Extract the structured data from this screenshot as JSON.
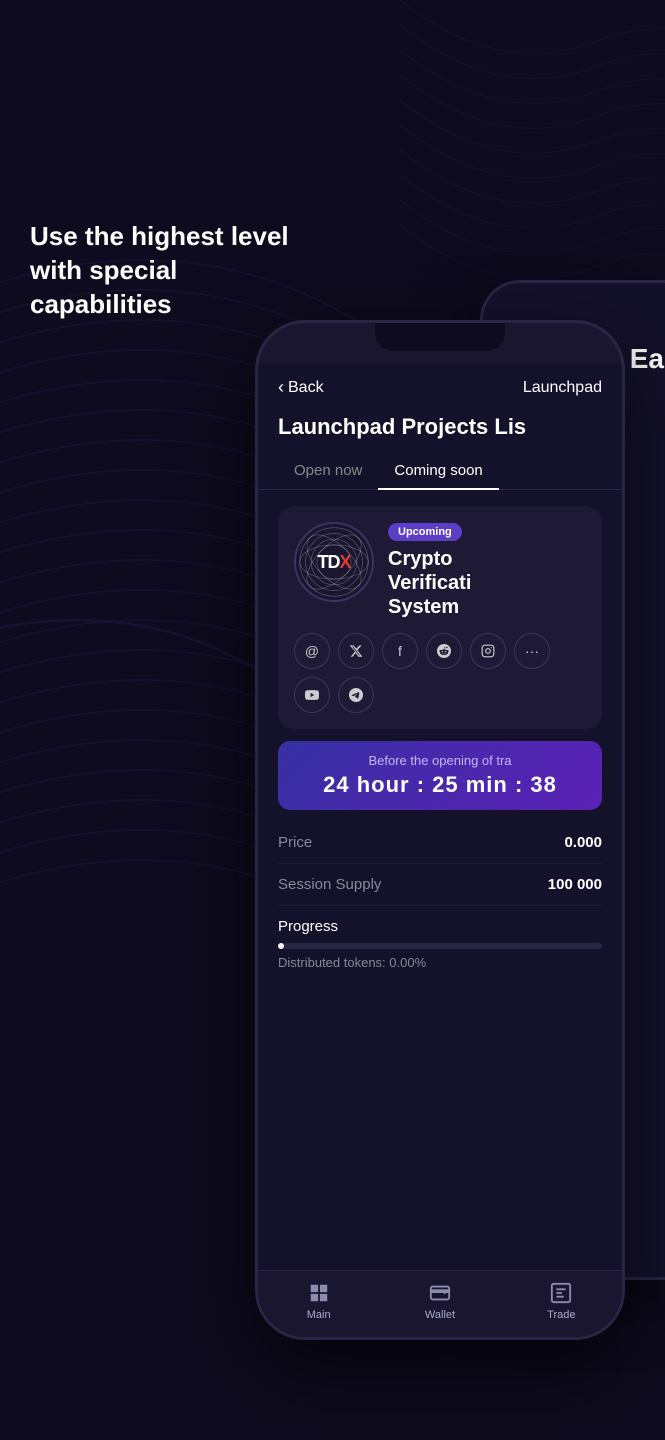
{
  "background": {
    "color": "#0e0b1e"
  },
  "headline": {
    "text": "Use the highest level with special capabilities"
  },
  "phone": {
    "header": {
      "back_label": "Back",
      "title": "Launchpad"
    },
    "page_title": "Launchpad Projects Lis",
    "tabs": [
      {
        "label": "Open now",
        "active": false
      },
      {
        "label": "Coming soon",
        "active": true
      }
    ],
    "project": {
      "badge": "Upcoming",
      "logo_text_main": "TDX",
      "logo_text_accent": "X",
      "name_line1": "Crypto",
      "name_line2": "Verificati",
      "name_line3": "System"
    },
    "social_icons": [
      {
        "name": "at-icon",
        "symbol": "@"
      },
      {
        "name": "twitter-icon",
        "symbol": "𝕏"
      },
      {
        "name": "facebook-icon",
        "symbol": "f"
      },
      {
        "name": "reddit-icon",
        "symbol": "r"
      },
      {
        "name": "instagram-icon",
        "symbol": "◻"
      },
      {
        "name": "extra-icon",
        "symbol": "…"
      },
      {
        "name": "youtube-icon",
        "symbol": "▶"
      },
      {
        "name": "telegram-icon",
        "symbol": "✈"
      }
    ],
    "timer": {
      "label": "Before the opening of tra",
      "value": "24 hour : 25 min : 38"
    },
    "price": {
      "label": "Price",
      "value": "0.000"
    },
    "session_supply": {
      "label": "Session Supply",
      "value": "100 000"
    },
    "progress": {
      "label": "Progress",
      "fill_percent": 2,
      "distributed_text": "Distributed tokens: 0.00%"
    },
    "bottom_nav": [
      {
        "name": "main-nav",
        "icon": "⊞",
        "label": "Main"
      },
      {
        "name": "wallet-nav",
        "icon": "▣",
        "label": "Wallet"
      },
      {
        "name": "trade-nav",
        "icon": "⊟",
        "label": "Trade"
      }
    ]
  },
  "second_phone": {
    "visible_text": "Ea"
  }
}
